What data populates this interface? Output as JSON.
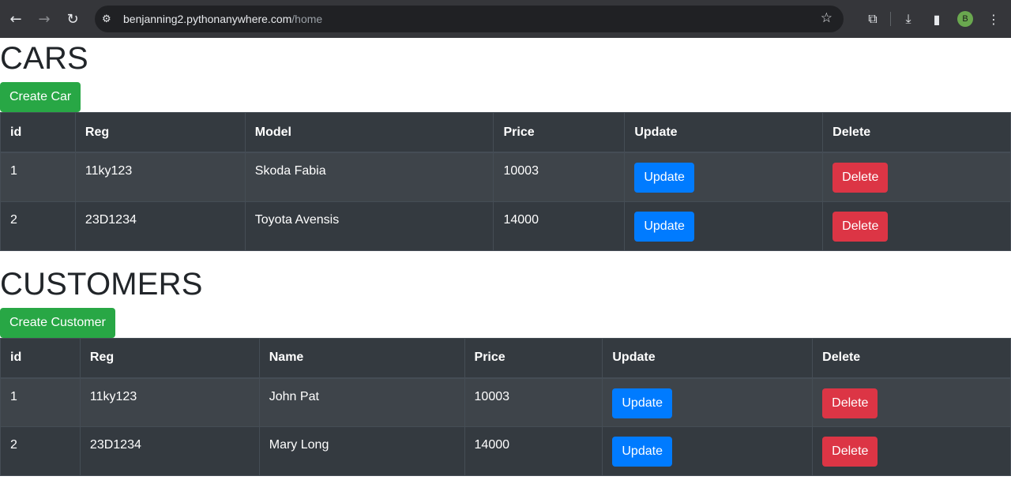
{
  "browser": {
    "url_host": "benjanning2.pythonanywhere.com",
    "url_path": "/home",
    "profile_initial": "B"
  },
  "cars": {
    "title": "CARS",
    "create_label": "Create Car",
    "headers": [
      "id",
      "Reg",
      "Model",
      "Price",
      "Update",
      "Delete"
    ],
    "rows": [
      {
        "id": "1",
        "reg": "11ky123",
        "model": "Skoda Fabia",
        "price": "10003",
        "update": "Update",
        "delete": "Delete"
      },
      {
        "id": "2",
        "reg": "23D1234",
        "model": "Toyota Avensis",
        "price": "14000",
        "update": "Update",
        "delete": "Delete"
      }
    ]
  },
  "customers": {
    "title": "CUSTOMERS",
    "create_label": "Create Customer",
    "headers": [
      "id",
      "Reg",
      "Name",
      "Price",
      "Update",
      "Delete"
    ],
    "rows": [
      {
        "id": "1",
        "reg": "11ky123",
        "name": "John Pat",
        "price": "10003",
        "update": "Update",
        "delete": "Delete"
      },
      {
        "id": "2",
        "reg": "23D1234",
        "name": "Mary Long",
        "price": "14000",
        "update": "Update",
        "delete": "Delete"
      }
    ]
  },
  "colors": {
    "create": "#28a745",
    "update": "#007bff",
    "delete": "#dc3545",
    "table_dark": "#343a40"
  }
}
